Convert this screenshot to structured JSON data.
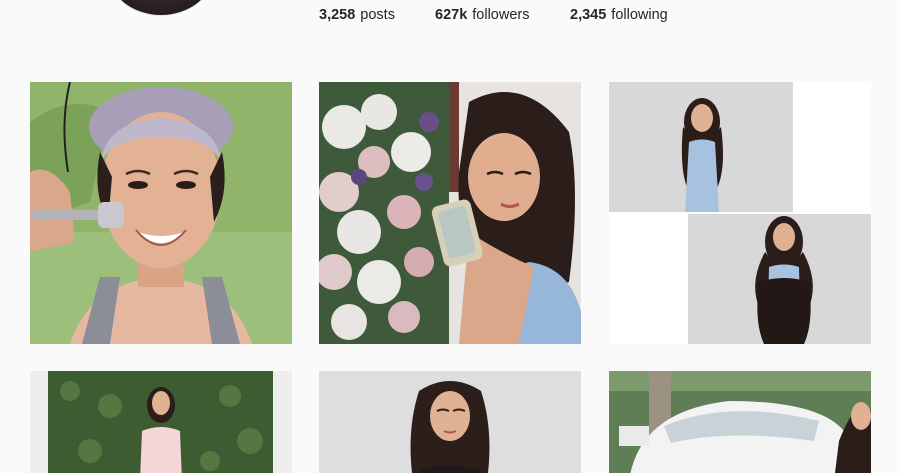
{
  "profile": {
    "stats": {
      "posts_count": "3,258",
      "posts_label": "posts",
      "followers_count": "627k",
      "followers_label": "followers",
      "following_count": "2,345",
      "following_label": "following"
    }
  },
  "grid": {
    "colors": {
      "background": "#fafafa",
      "text": "#262626"
    }
  }
}
